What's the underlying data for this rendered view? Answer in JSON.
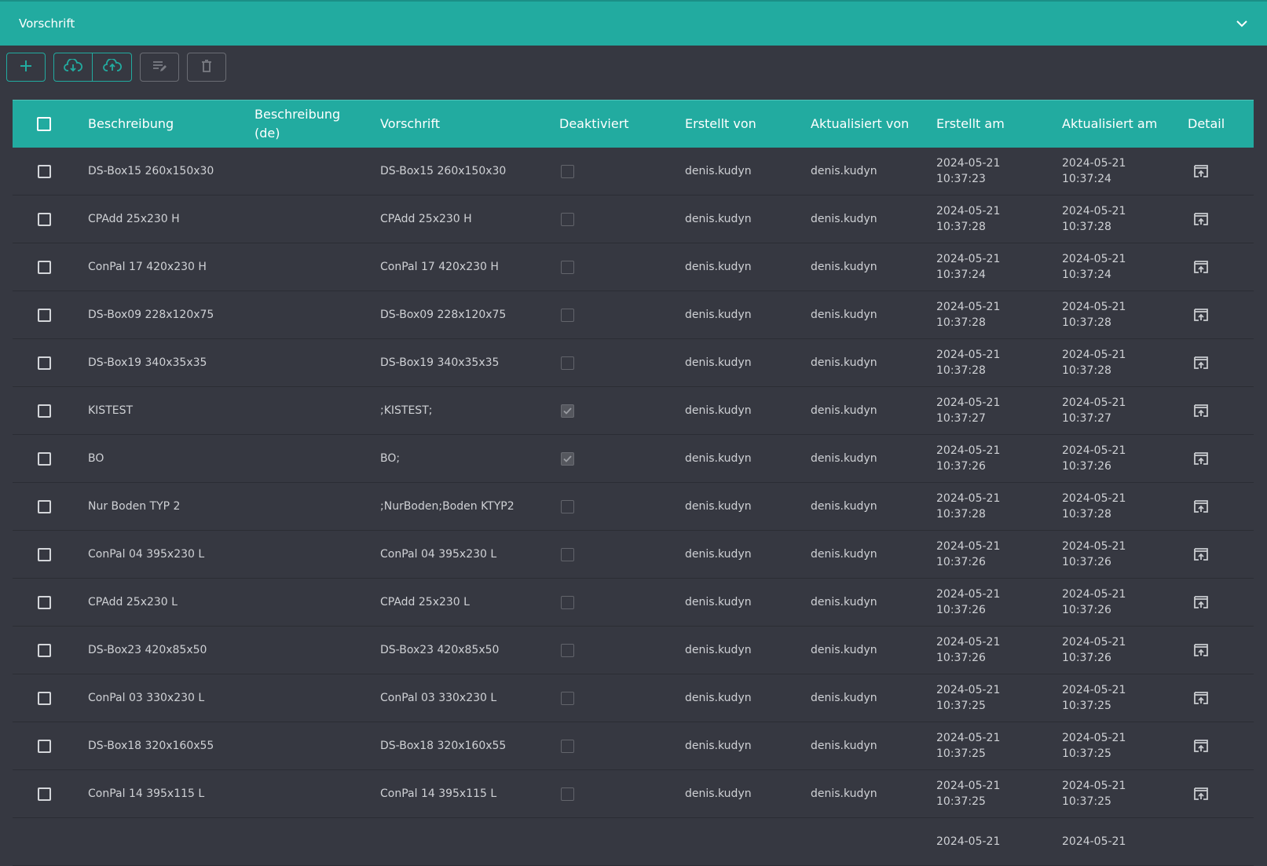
{
  "panel": {
    "title": "Vorschrift"
  },
  "toolbar": {
    "add": "plus-icon",
    "download": "cloud-download-icon",
    "upload": "cloud-upload-icon",
    "edit": "edit-list-icon",
    "delete": "trash-icon"
  },
  "colors": {
    "accent": "#22aba0",
    "background": "#363841",
    "text": "#cfd1d5"
  },
  "columns": [
    "Beschreibung",
    "Beschreibung (de)",
    "Vorschrift",
    "Deaktiviert",
    "Erstellt von",
    "Aktualisiert von",
    "Erstellt am",
    "Aktualisiert am",
    "Detail"
  ],
  "rows": [
    {
      "beschreibung": "DS-Box15 260x150x30",
      "beschreibung_de": "",
      "vorschrift": "DS-Box15 260x150x30",
      "deaktiviert": false,
      "erstellt_von": "denis.kudyn",
      "aktualisiert_von": "denis.kudyn",
      "erstellt_datum": "2024-05-21",
      "erstellt_zeit": "10:37:23",
      "aktualisiert_datum": "2024-05-21",
      "aktualisiert_zeit": "10:37:24"
    },
    {
      "beschreibung": "CPAdd 25x230 H",
      "beschreibung_de": "",
      "vorschrift": "CPAdd 25x230 H",
      "deaktiviert": false,
      "erstellt_von": "denis.kudyn",
      "aktualisiert_von": "denis.kudyn",
      "erstellt_datum": "2024-05-21",
      "erstellt_zeit": "10:37:28",
      "aktualisiert_datum": "2024-05-21",
      "aktualisiert_zeit": "10:37:28"
    },
    {
      "beschreibung": "ConPal 17 420x230 H",
      "beschreibung_de": "",
      "vorschrift": "ConPal 17 420x230 H",
      "deaktiviert": false,
      "erstellt_von": "denis.kudyn",
      "aktualisiert_von": "denis.kudyn",
      "erstellt_datum": "2024-05-21",
      "erstellt_zeit": "10:37:24",
      "aktualisiert_datum": "2024-05-21",
      "aktualisiert_zeit": "10:37:24"
    },
    {
      "beschreibung": "DS-Box09 228x120x75",
      "beschreibung_de": "",
      "vorschrift": "DS-Box09 228x120x75",
      "deaktiviert": false,
      "erstellt_von": "denis.kudyn",
      "aktualisiert_von": "denis.kudyn",
      "erstellt_datum": "2024-05-21",
      "erstellt_zeit": "10:37:28",
      "aktualisiert_datum": "2024-05-21",
      "aktualisiert_zeit": "10:37:28"
    },
    {
      "beschreibung": "DS-Box19 340x35x35",
      "beschreibung_de": "",
      "vorschrift": "DS-Box19 340x35x35",
      "deaktiviert": false,
      "erstellt_von": "denis.kudyn",
      "aktualisiert_von": "denis.kudyn",
      "erstellt_datum": "2024-05-21",
      "erstellt_zeit": "10:37:28",
      "aktualisiert_datum": "2024-05-21",
      "aktualisiert_zeit": "10:37:28"
    },
    {
      "beschreibung": "KISTEST",
      "beschreibung_de": "",
      "vorschrift": ";KISTEST;",
      "deaktiviert": true,
      "erstellt_von": "denis.kudyn",
      "aktualisiert_von": "denis.kudyn",
      "erstellt_datum": "2024-05-21",
      "erstellt_zeit": "10:37:27",
      "aktualisiert_datum": "2024-05-21",
      "aktualisiert_zeit": "10:37:27"
    },
    {
      "beschreibung": "BO",
      "beschreibung_de": "",
      "vorschrift": "BO;",
      "deaktiviert": true,
      "erstellt_von": "denis.kudyn",
      "aktualisiert_von": "denis.kudyn",
      "erstellt_datum": "2024-05-21",
      "erstellt_zeit": "10:37:26",
      "aktualisiert_datum": "2024-05-21",
      "aktualisiert_zeit": "10:37:26"
    },
    {
      "beschreibung": "Nur Boden TYP 2",
      "beschreibung_de": "",
      "vorschrift": ";NurBoden;Boden KTYP2",
      "deaktiviert": false,
      "erstellt_von": "denis.kudyn",
      "aktualisiert_von": "denis.kudyn",
      "erstellt_datum": "2024-05-21",
      "erstellt_zeit": "10:37:28",
      "aktualisiert_datum": "2024-05-21",
      "aktualisiert_zeit": "10:37:28"
    },
    {
      "beschreibung": "ConPal 04 395x230 L",
      "beschreibung_de": "",
      "vorschrift": "ConPal 04 395x230 L",
      "deaktiviert": false,
      "erstellt_von": "denis.kudyn",
      "aktualisiert_von": "denis.kudyn",
      "erstellt_datum": "2024-05-21",
      "erstellt_zeit": "10:37:26",
      "aktualisiert_datum": "2024-05-21",
      "aktualisiert_zeit": "10:37:26"
    },
    {
      "beschreibung": "CPAdd 25x230 L",
      "beschreibung_de": "",
      "vorschrift": "CPAdd 25x230 L",
      "deaktiviert": false,
      "erstellt_von": "denis.kudyn",
      "aktualisiert_von": "denis.kudyn",
      "erstellt_datum": "2024-05-21",
      "erstellt_zeit": "10:37:26",
      "aktualisiert_datum": "2024-05-21",
      "aktualisiert_zeit": "10:37:26"
    },
    {
      "beschreibung": "DS-Box23 420x85x50",
      "beschreibung_de": "",
      "vorschrift": "DS-Box23 420x85x50",
      "deaktiviert": false,
      "erstellt_von": "denis.kudyn",
      "aktualisiert_von": "denis.kudyn",
      "erstellt_datum": "2024-05-21",
      "erstellt_zeit": "10:37:26",
      "aktualisiert_datum": "2024-05-21",
      "aktualisiert_zeit": "10:37:26"
    },
    {
      "beschreibung": "ConPal 03 330x230 L",
      "beschreibung_de": "",
      "vorschrift": "ConPal 03 330x230 L",
      "deaktiviert": false,
      "erstellt_von": "denis.kudyn",
      "aktualisiert_von": "denis.kudyn",
      "erstellt_datum": "2024-05-21",
      "erstellt_zeit": "10:37:25",
      "aktualisiert_datum": "2024-05-21",
      "aktualisiert_zeit": "10:37:25"
    },
    {
      "beschreibung": "DS-Box18 320x160x55",
      "beschreibung_de": "",
      "vorschrift": "DS-Box18 320x160x55",
      "deaktiviert": false,
      "erstellt_von": "denis.kudyn",
      "aktualisiert_von": "denis.kudyn",
      "erstellt_datum": "2024-05-21",
      "erstellt_zeit": "10:37:25",
      "aktualisiert_datum": "2024-05-21",
      "aktualisiert_zeit": "10:37:25"
    },
    {
      "beschreibung": "ConPal 14 395x115 L",
      "beschreibung_de": "",
      "vorschrift": "ConPal 14 395x115 L",
      "deaktiviert": false,
      "erstellt_von": "denis.kudyn",
      "aktualisiert_von": "denis.kudyn",
      "erstellt_datum": "2024-05-21",
      "erstellt_zeit": "10:37:25",
      "aktualisiert_datum": "2024-05-21",
      "aktualisiert_zeit": "10:37:25"
    },
    {
      "beschreibung": "",
      "beschreibung_de": "",
      "vorschrift": "",
      "deaktiviert": false,
      "erstellt_von": "",
      "aktualisiert_von": "",
      "erstellt_datum": "2024-05-21",
      "erstellt_zeit": "",
      "aktualisiert_datum": "2024-05-21",
      "aktualisiert_zeit": ""
    }
  ]
}
